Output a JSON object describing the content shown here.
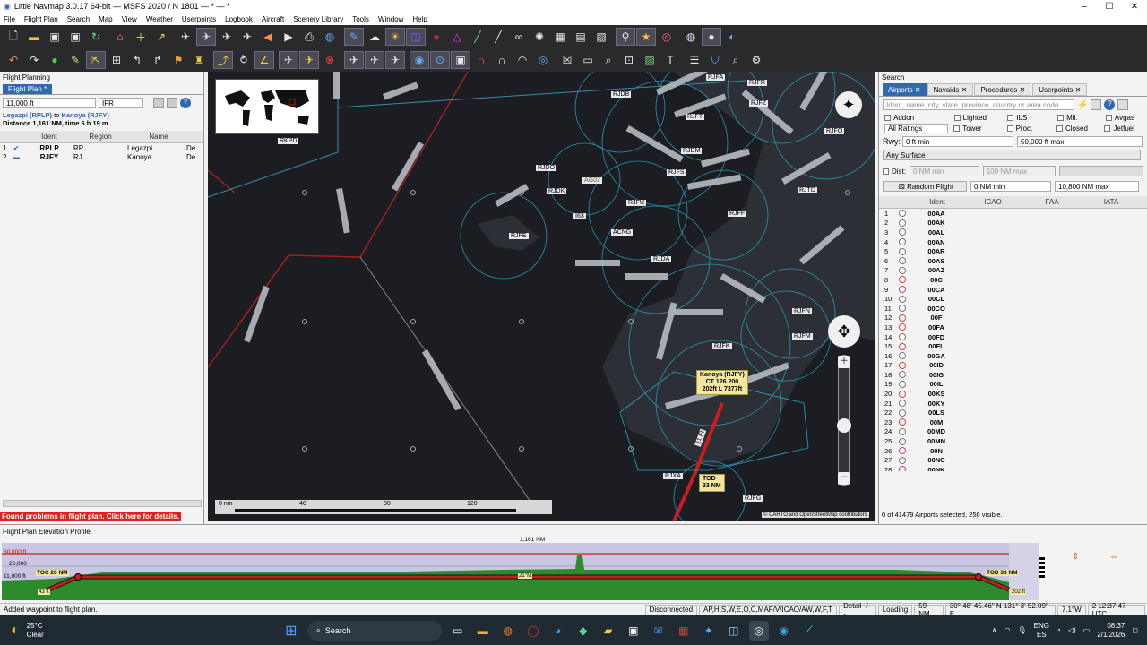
{
  "window": {
    "title": "Little Navmap 3.0.17 64-bit — MSFS 2020 / N 1801 — * — *"
  },
  "menu": [
    "File",
    "Flight Plan",
    "Search",
    "Map",
    "View",
    "Weather",
    "Userpoints",
    "Logbook",
    "Aircraft",
    "Scenery Library",
    "Tools",
    "Window",
    "Help"
  ],
  "left": {
    "panel_title": "Flight Planning",
    "tab": "Flight Plan *",
    "altitude": "11,000 ft",
    "flight_rules": "IFR",
    "route_from": "Legazpi (RPLP)",
    "route_to": "Kanoya (RJFY)",
    "route_to_word": "to",
    "distance_line": "Distance 1,161 NM, time 6 h 19 m.",
    "columns": [
      "Ident",
      "Region",
      "Name"
    ],
    "rows": [
      {
        "num": "1",
        "ident": "RPLP",
        "region": "RP",
        "name": "Legazpi",
        "extra": "De"
      },
      {
        "num": "2",
        "ident": "RJFY",
        "region": "RJ",
        "name": "Kanoya",
        "extra": "De"
      }
    ],
    "error": "Found problems in flight plan. Click here for details."
  },
  "map": {
    "scale_labels": [
      "0 nm",
      "40",
      "80",
      "120"
    ],
    "attribution": "© CARTO and OpenStreetMap contributors",
    "airports": [
      "RJFA",
      "RJFR",
      "RJDB",
      "RJFZ",
      "RJFO",
      "RJFT",
      "RJDM",
      "RJFS",
      "RJTD",
      "RJFU",
      "RJFF",
      "RJDK",
      "RJDO",
      "AG02",
      "I63",
      "ACNG",
      "RJFE",
      "RJDA",
      "RJFN",
      "RJFM",
      "RJFK",
      "RKPD",
      "RJXA",
      "RJFG"
    ],
    "destination_label": [
      "Kanoya (RJFY)",
      "CT 126.200",
      "202ft L 7377ft"
    ],
    "tod_label": [
      "TOD",
      "33 NM"
    ],
    "course_label": "11 Ft"
  },
  "search": {
    "panel_title": "Search",
    "tabs": [
      "Airports",
      "Navaids",
      "Procedures",
      "Userpoints"
    ],
    "placeholder": "Ident, name, city, state, province, country or area code",
    "checks_row1": [
      "Addon",
      "Lighted",
      "ILS",
      "Mil.",
      "Avgas"
    ],
    "checks_row2": [
      "Tower",
      "Proc.",
      "Closed",
      "Jetfuel"
    ],
    "ratings": "All Ratings",
    "rwy_label": "Rwy:",
    "rwy_min": "0 ft min",
    "rwy_max": "50,000 ft max",
    "surface": "Any Surface",
    "dist_label": "Dist:",
    "dist_min": "0 NM min",
    "dist_max": "100 NM max",
    "random_flight": "Random Flight",
    "rf_min": "0 NM min",
    "rf_max": "10,800 NM max",
    "columns": [
      "Ident",
      "ICAO",
      "FAA",
      "IATA"
    ],
    "rows": [
      "00AA",
      "00AK",
      "00AL",
      "00AN",
      "00AR",
      "00AS",
      "00AZ",
      "00C",
      "00CA",
      "00CL",
      "00CO",
      "00F",
      "00FA",
      "00FD",
      "00FL",
      "00GA",
      "00ID",
      "00IG",
      "00IL",
      "00KS",
      "00KY",
      "00LS",
      "00M",
      "00MD",
      "00MN",
      "00N",
      "00NC",
      "00NK"
    ],
    "status": "0 of 41479 Airports selected, 256 visible."
  },
  "profile": {
    "title": "Flight Plan Elevation Profile",
    "total": "1,161 NM",
    "alt_labels": [
      "30,000 ft",
      "20,000",
      "11,000 ft"
    ],
    "toc": "TOC 26 NM",
    "tod": "TOD 33 NM",
    "mid": "21°M",
    "start_alt": "43 ft",
    "end_alt": "202 ft"
  },
  "status": {
    "message": "Added waypoint to flight plan.",
    "connection": "Disconnected",
    "filters": "AP,H,S,W,E,O,C,MAF/V/ICAO/AW,W,F,T",
    "detail": "Detail -/--",
    "loading": "Loading",
    "range": "59 NM",
    "coords": "30° 48' 45.46\" N 131° 3' 52.09\" E",
    "mag": "7.1°W",
    "time": "2 12:37:47 UTC"
  },
  "taskbar": {
    "weather_temp": "25°C",
    "weather_desc": "Clear",
    "search": "Search",
    "lang1": "ENG",
    "lang2": "ES",
    "clock": "08:37",
    "date": "2/1/2026"
  }
}
